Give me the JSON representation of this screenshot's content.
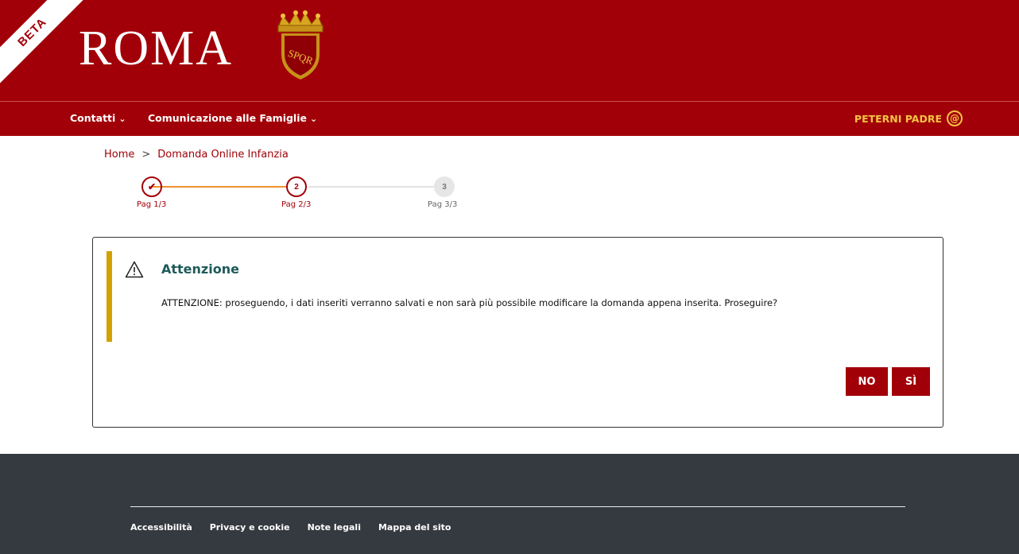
{
  "header": {
    "beta_label": "BETA",
    "logo_text": "ROMA",
    "crest_text": "SPQR"
  },
  "nav": {
    "items": [
      {
        "label": "Contatti"
      },
      {
        "label": "Comunicazione alle Famiglie"
      }
    ],
    "user_name": "PETERNI PADRE"
  },
  "breadcrumb": {
    "home": "Home",
    "separator": ">",
    "current": "Domanda Online Infanzia"
  },
  "stepper": {
    "steps": [
      {
        "number": "✔",
        "label": "Pag 1/3",
        "state": "done"
      },
      {
        "number": "2",
        "label": "Pag 2/3",
        "state": "current"
      },
      {
        "number": "3",
        "label": "Pag 3/3",
        "state": "pending"
      }
    ]
  },
  "dialog": {
    "title": "Attenzione",
    "message": "ATTENZIONE: proseguendo, i dati inseriti verranno salvati e non sarà più possibile modificare la domanda appena inserita. Proseguire?",
    "no_label": "NO",
    "yes_label": "SÌ"
  },
  "footer": {
    "links": [
      {
        "label": "Accessibilità"
      },
      {
        "label": "Privacy e cookie"
      },
      {
        "label": "Note legali"
      },
      {
        "label": "Mappa del sito"
      }
    ]
  },
  "colors": {
    "brand_red": "#a20008",
    "accent_orange": "#f0922e",
    "user_gold": "#f5c242",
    "alert_yellow": "#d4a100",
    "footer_bg": "#353a40"
  }
}
